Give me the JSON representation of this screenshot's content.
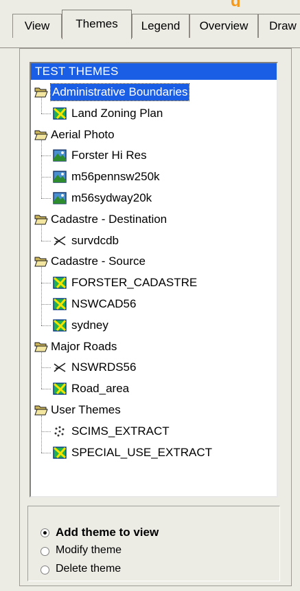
{
  "tabs": [
    {
      "label": "View",
      "selected": false
    },
    {
      "label": "Themes",
      "selected": true
    },
    {
      "label": "Legend",
      "selected": false
    },
    {
      "label": "Overview",
      "selected": false
    },
    {
      "label": "Draw",
      "selected": false
    }
  ],
  "tree": {
    "header": "TEST THEMES",
    "groups": [
      {
        "label": "Administrative Boundaries",
        "selected": true,
        "icon": "folder-open-icon",
        "children": [
          {
            "label": "Land Zoning Plan",
            "icon": "polygon-theme-icon"
          }
        ]
      },
      {
        "label": "Aerial Photo",
        "icon": "folder-open-icon",
        "children": [
          {
            "label": "Forster Hi Res",
            "icon": "image-theme-icon"
          },
          {
            "label": "m56pennsw250k",
            "icon": "image-theme-icon"
          },
          {
            "label": "m56sydway20k",
            "icon": "image-theme-icon"
          }
        ]
      },
      {
        "label": "Cadastre - Destination",
        "icon": "folder-open-icon",
        "children": [
          {
            "label": "survdcdb",
            "icon": "line-theme-icon"
          }
        ]
      },
      {
        "label": "Cadastre - Source",
        "icon": "folder-open-icon",
        "children": [
          {
            "label": "FORSTER_CADASTRE",
            "icon": "polygon-theme-icon"
          },
          {
            "label": "NSWCAD56",
            "icon": "polygon-theme-icon"
          },
          {
            "label": "sydney",
            "icon": "polygon-theme-icon"
          }
        ]
      },
      {
        "label": "Major Roads",
        "icon": "folder-open-icon",
        "children": [
          {
            "label": "NSWRDS56",
            "icon": "line-theme-icon"
          },
          {
            "label": "Road_area",
            "icon": "polygon-theme-icon"
          }
        ]
      },
      {
        "label": "User Themes",
        "icon": "folder-open-icon",
        "children": [
          {
            "label": "SCIMS_EXTRACT",
            "icon": "point-theme-icon"
          },
          {
            "label": "SPECIAL_USE_EXTRACT",
            "icon": "polygon-theme-icon"
          }
        ]
      }
    ]
  },
  "options": [
    {
      "label": "Add theme to view",
      "checked": true
    },
    {
      "label": "Modify theme",
      "checked": false
    },
    {
      "label": "Delete theme",
      "checked": false
    }
  ]
}
